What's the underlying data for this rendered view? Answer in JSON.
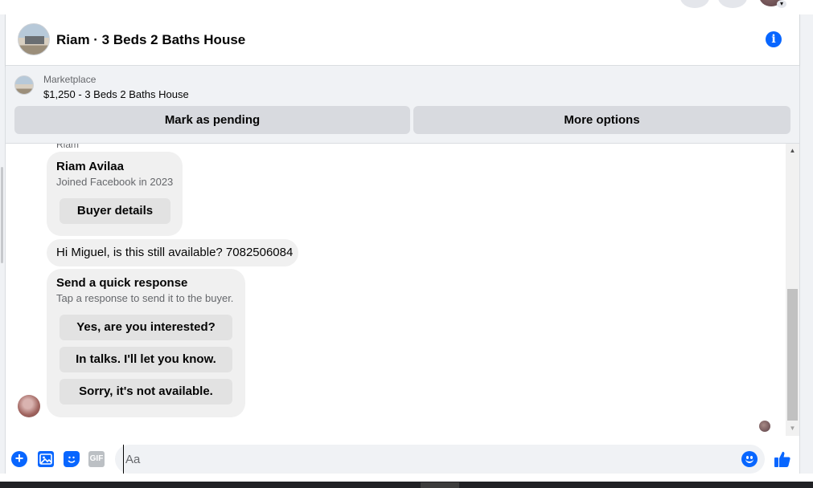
{
  "header": {
    "title": "Riam · 3 Beds 2 Baths House"
  },
  "marketplace": {
    "kicker": "Marketplace",
    "listing": "$1,250 - 3 Beds 2 Baths House",
    "mark_pending_label": "Mark as pending",
    "more_options_label": "More options"
  },
  "conversation": {
    "sender_name_small": "Riam",
    "profile_card": {
      "name": "Riam Avilaa",
      "subtitle": "Joined Facebook in 2023",
      "button_label": "Buyer details"
    },
    "message": "Hi Miguel, is this still available? 7082506084",
    "quick_response": {
      "title": "Send a quick response",
      "subtitle": "Tap a response to send it to the buyer.",
      "options": [
        "Yes, are you interested?",
        "In talks. I'll let you know.",
        "Sorry, it's not available."
      ]
    }
  },
  "composer": {
    "placeholder": "Aa",
    "gif_label": "GIF"
  },
  "icons": {
    "info": "info-icon",
    "plus": "plus-circle-icon",
    "image": "image-icon",
    "sticker": "sticker-icon",
    "gif": "gif-icon",
    "emoji": "emoji-icon",
    "like": "thumbs-up-icon"
  },
  "colors": {
    "accent": "#0866ff",
    "bubble": "#f0f0f0",
    "banner": "#f0f2f5"
  }
}
